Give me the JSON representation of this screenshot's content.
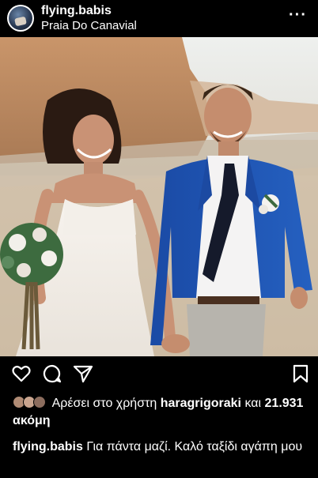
{
  "post": {
    "username": "flying.babis",
    "location": "Praia Do Canavial",
    "more_label": "···"
  },
  "actions": {
    "icons": [
      "heart-icon",
      "comment-icon",
      "share-icon",
      "bookmark-icon"
    ]
  },
  "likes": {
    "prefix": "Αρέσει στο χρήστη",
    "user": "haragrigoraki",
    "and": "και",
    "count": "21.931 ακόμη"
  },
  "caption": {
    "username": "flying.babis",
    "text": "Για πάντα μαζί. Καλό ταξίδι αγάπη μου"
  },
  "colors": {
    "background": "#000000",
    "text": "#ffffff",
    "suit": "#1f4fa8"
  }
}
